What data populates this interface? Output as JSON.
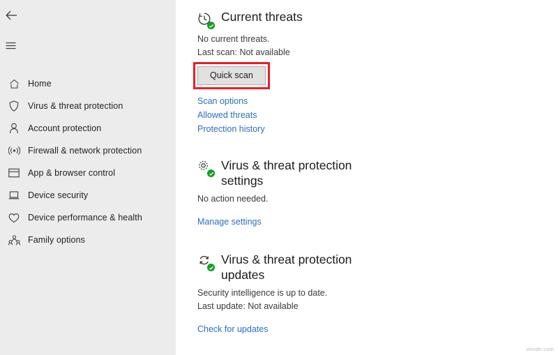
{
  "sidebar": {
    "back_icon": "back-arrow-icon",
    "menu_icon": "hamburger-menu-icon",
    "items": [
      {
        "label": "Home",
        "icon": "home-icon"
      },
      {
        "label": "Virus & threat protection",
        "icon": "shield-icon"
      },
      {
        "label": "Account protection",
        "icon": "person-icon"
      },
      {
        "label": "Firewall & network protection",
        "icon": "wireless-signal-icon"
      },
      {
        "label": "App & browser control",
        "icon": "browser-window-icon"
      },
      {
        "label": "Device security",
        "icon": "laptop-icon"
      },
      {
        "label": "Device performance & health",
        "icon": "heart-shield-icon"
      },
      {
        "label": "Family options",
        "icon": "family-people-icon"
      }
    ]
  },
  "main": {
    "sections": [
      {
        "title": "Current threats",
        "icon": "clock-history-icon",
        "badge": "green-check-badge",
        "lines": [
          "No current threats.",
          "Last scan: Not available"
        ],
        "button": "Quick scan",
        "links": [
          "Scan options",
          "Allowed threats",
          "Protection history"
        ]
      },
      {
        "title": "Virus & threat protection settings",
        "icon": "gear-settings-icon",
        "badge": "green-check-badge",
        "lines": [
          "No action needed."
        ],
        "links": [
          "Manage settings"
        ]
      },
      {
        "title": "Virus & threat protection updates",
        "icon": "sync-refresh-icon",
        "badge": "green-check-badge",
        "lines": [
          "Security intelligence is up to date.",
          "Last update: Not available"
        ],
        "links": [
          "Check for updates"
        ]
      }
    ]
  },
  "annotation": {
    "highlight_color": "#ee1c25",
    "highlight_target": "Quick scan"
  },
  "watermark": {
    "text": "wsxdn.com"
  },
  "colors": {
    "sidebar_bg": "#ececec",
    "content_bg": "#ffffff",
    "link": "#2a6fc0",
    "status_green": "#11a01e",
    "button_bg": "#e1e1e1"
  }
}
